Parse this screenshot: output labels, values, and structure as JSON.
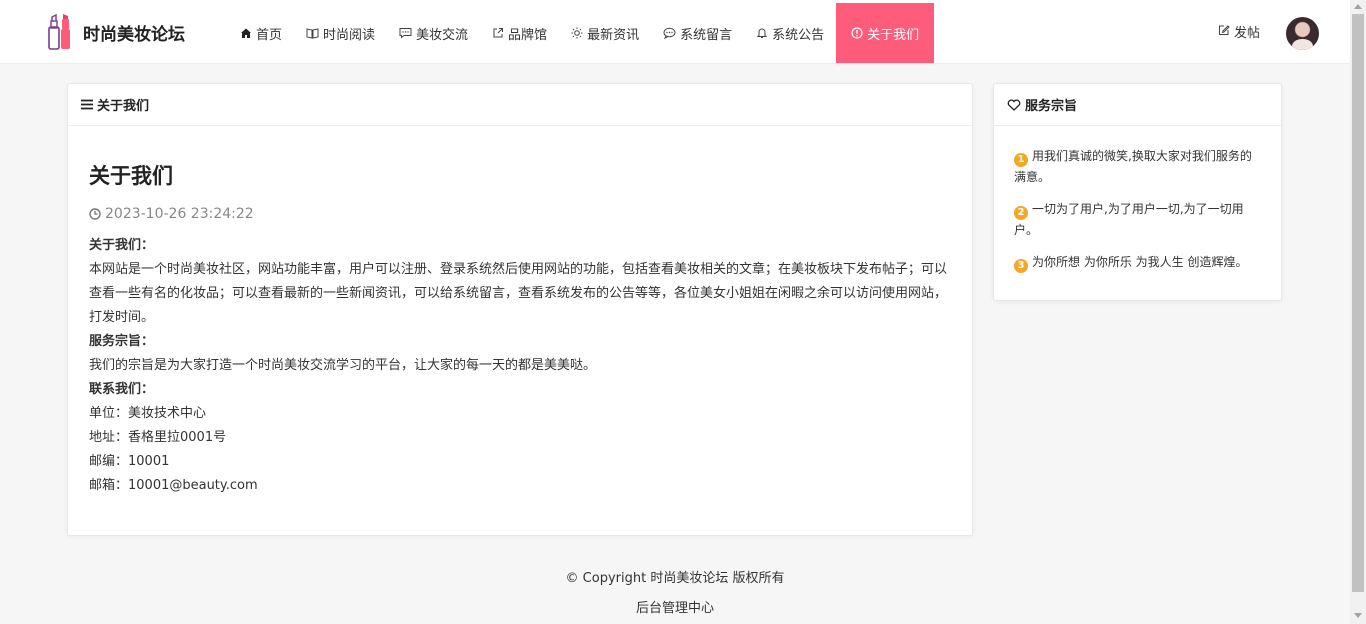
{
  "brand": {
    "name": "时尚美妆论坛",
    "accent": "#ff5c7c",
    "logo_icon": "lipstick-icon"
  },
  "nav": {
    "items": [
      {
        "label": "首页",
        "icon": "home-icon"
      },
      {
        "label": "时尚阅读",
        "icon": "book-icon"
      },
      {
        "label": "美妆交流",
        "icon": "chat-icon"
      },
      {
        "label": "品牌馆",
        "icon": "external-link-icon"
      },
      {
        "label": "最新资讯",
        "icon": "sun-icon"
      },
      {
        "label": "系统留言",
        "icon": "comment-icon"
      },
      {
        "label": "系统公告",
        "icon": "bell-icon"
      },
      {
        "label": "关于我们",
        "icon": "info-icon",
        "active": true
      }
    ],
    "post_label": "发帖"
  },
  "main": {
    "header": "关于我们",
    "title": "关于我们",
    "date": "2023-10-26 23:24:22",
    "paragraphs": [
      {
        "text": "关于我们：",
        "bold": true
      },
      {
        "text": "本网站是一个时尚美妆社区，网站功能丰富，用户可以注册、登录系统然后使用网站的功能，包括查看美妆相关的文章；在美妆板块下发布帖子；可以查看一些有名的化妆品；可以查看最新的一些新闻资讯，可以给系统留言，查看系统发布的公告等等，各位美女小姐姐在闲暇之余可以访问使用网站，打发时间。",
        "bold": false
      },
      {
        "text": "服务宗旨：",
        "bold": true
      },
      {
        "text": "我们的宗旨是为大家打造一个时尚美妆交流学习的平台，让大家的每一天的都是美美哒。",
        "bold": false
      },
      {
        "text": "联系我们：",
        "bold": true
      },
      {
        "text": "单位：美妆技术中心",
        "bold": false
      },
      {
        "text": "地址：香格里拉0001号",
        "bold": false
      },
      {
        "text": "邮编：10001",
        "bold": false
      },
      {
        "text": "邮箱：10001@beauty.com",
        "bold": false
      }
    ]
  },
  "side": {
    "header": "服务宗旨",
    "items": [
      {
        "num": "1",
        "text": "用我们真诚的微笑,换取大家对我们服务的满意。"
      },
      {
        "num": "2",
        "text": "一切为了用户,为了用户一切,为了一切用户。"
      },
      {
        "num": "3",
        "text": "为你所想 为你所乐 为我人生 创造辉煌。"
      }
    ]
  },
  "footer": {
    "copyright": "© Copyright 时尚美妆论坛 版权所有",
    "admin_link": "后台管理中心"
  }
}
